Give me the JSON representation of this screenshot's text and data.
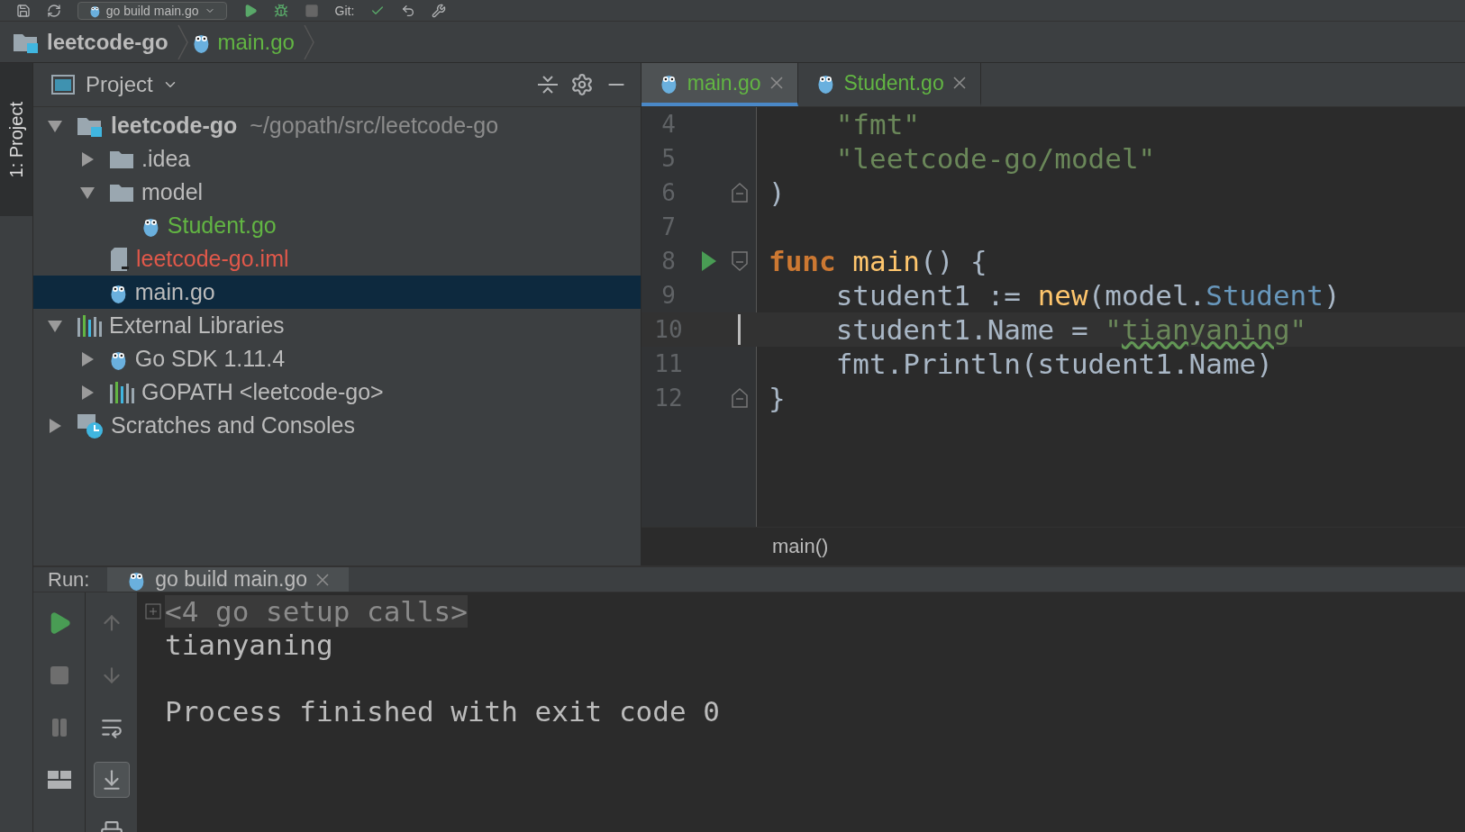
{
  "toolbar": {
    "run_config": "go build main.go",
    "vcs_label": "Git:"
  },
  "breadcrumbs": [
    {
      "label": "leetcode-go",
      "kind": "module"
    },
    {
      "label": "main.go",
      "kind": "gofile"
    }
  ],
  "side_stripe": {
    "tab": "1: Project",
    "selected": true
  },
  "project_panel": {
    "title": "Project",
    "tree": [
      {
        "label": "leetcode-go",
        "kind": "module",
        "hint": "~/gopath/src/leetcode-go",
        "expanded": true,
        "selected": false,
        "children": [
          {
            "label": ".idea",
            "kind": "folder",
            "expanded": false,
            "selected": false
          },
          {
            "label": "model",
            "kind": "folder",
            "expanded": true,
            "selected": false,
            "children": [
              {
                "label": "Student.go",
                "kind": "gofile",
                "color": "#62b543",
                "selected": false
              }
            ]
          },
          {
            "label": "leetcode-go.iml",
            "kind": "iml",
            "color": "#e0584a",
            "selected": false
          },
          {
            "label": "main.go",
            "kind": "gofile",
            "selected": true
          }
        ]
      },
      {
        "label": "External Libraries",
        "kind": "libraries",
        "expanded": true,
        "selected": false,
        "children": [
          {
            "label": "Go SDK 1.11.4",
            "kind": "gofile",
            "expanded": false,
            "selected": false
          },
          {
            "label": "GOPATH <leetcode-go>",
            "kind": "libraries",
            "expanded": false,
            "selected": false
          }
        ]
      },
      {
        "label": "Scratches and Consoles",
        "kind": "scratches",
        "expanded": false,
        "selected": false
      }
    ]
  },
  "editor": {
    "tabs": [
      {
        "label": "main.go",
        "selected": true
      },
      {
        "label": "Student.go",
        "selected": false
      }
    ],
    "lines": [
      {
        "number": "4",
        "run": false,
        "fold": false,
        "current": false,
        "tokens": [
          {
            "text": "    \"fmt\"",
            "kind": "string"
          }
        ]
      },
      {
        "number": "5",
        "run": false,
        "fold": false,
        "current": false,
        "tokens": [
          {
            "text": "    \"leetcode-go/model\"",
            "kind": "string"
          }
        ]
      },
      {
        "number": "6",
        "run": false,
        "fold": true,
        "current": false,
        "tokens": [
          {
            "text": ")",
            "kind": "plain"
          }
        ]
      },
      {
        "number": "7",
        "run": false,
        "fold": false,
        "current": false
      },
      {
        "number": "8",
        "run": true,
        "fold": true,
        "current": false,
        "tokens": [
          {
            "text": "func",
            "kind": "keyword"
          },
          {
            "text": " main",
            "kind": "function"
          },
          {
            "text": "() {",
            "kind": "plain"
          }
        ]
      },
      {
        "number": "9",
        "run": false,
        "fold": false,
        "current": false,
        "tokens": [
          {
            "text": "    student1 := ",
            "kind": "plain"
          },
          {
            "text": "new",
            "kind": "function"
          },
          {
            "text": "(model.",
            "kind": "plain"
          },
          {
            "text": "Student",
            "kind": "type"
          },
          {
            "text": ")",
            "kind": "plain"
          }
        ]
      },
      {
        "number": "10",
        "run": false,
        "fold": false,
        "current": true,
        "tokens": [
          {
            "text": "    student1.Name = ",
            "kind": "plain"
          },
          {
            "text": "\"",
            "kind": "string"
          },
          {
            "text": "tianyaning",
            "kind": "typo"
          },
          {
            "text": "\"",
            "kind": "string"
          }
        ]
      },
      {
        "number": "11",
        "run": false,
        "fold": false,
        "current": false,
        "tokens": [
          {
            "text": "    fmt.Println(student1.Name)",
            "kind": "plain"
          }
        ]
      },
      {
        "number": "12",
        "run": false,
        "fold": true,
        "current": false,
        "tokens": [
          {
            "text": "}",
            "kind": "plain"
          }
        ]
      }
    ],
    "breadcrumb": "main()"
  },
  "run_panel": {
    "label": "Run:",
    "tabs": [
      {
        "label": "go build main.go",
        "selected": true
      }
    ],
    "console": [
      {
        "text": "<4 go setup calls>",
        "kind": "folded"
      },
      {
        "text": "tianyaning",
        "kind": "output"
      },
      {
        "kind": "blank"
      },
      {
        "text": "Process finished with exit code 0",
        "kind": "output"
      }
    ]
  }
}
